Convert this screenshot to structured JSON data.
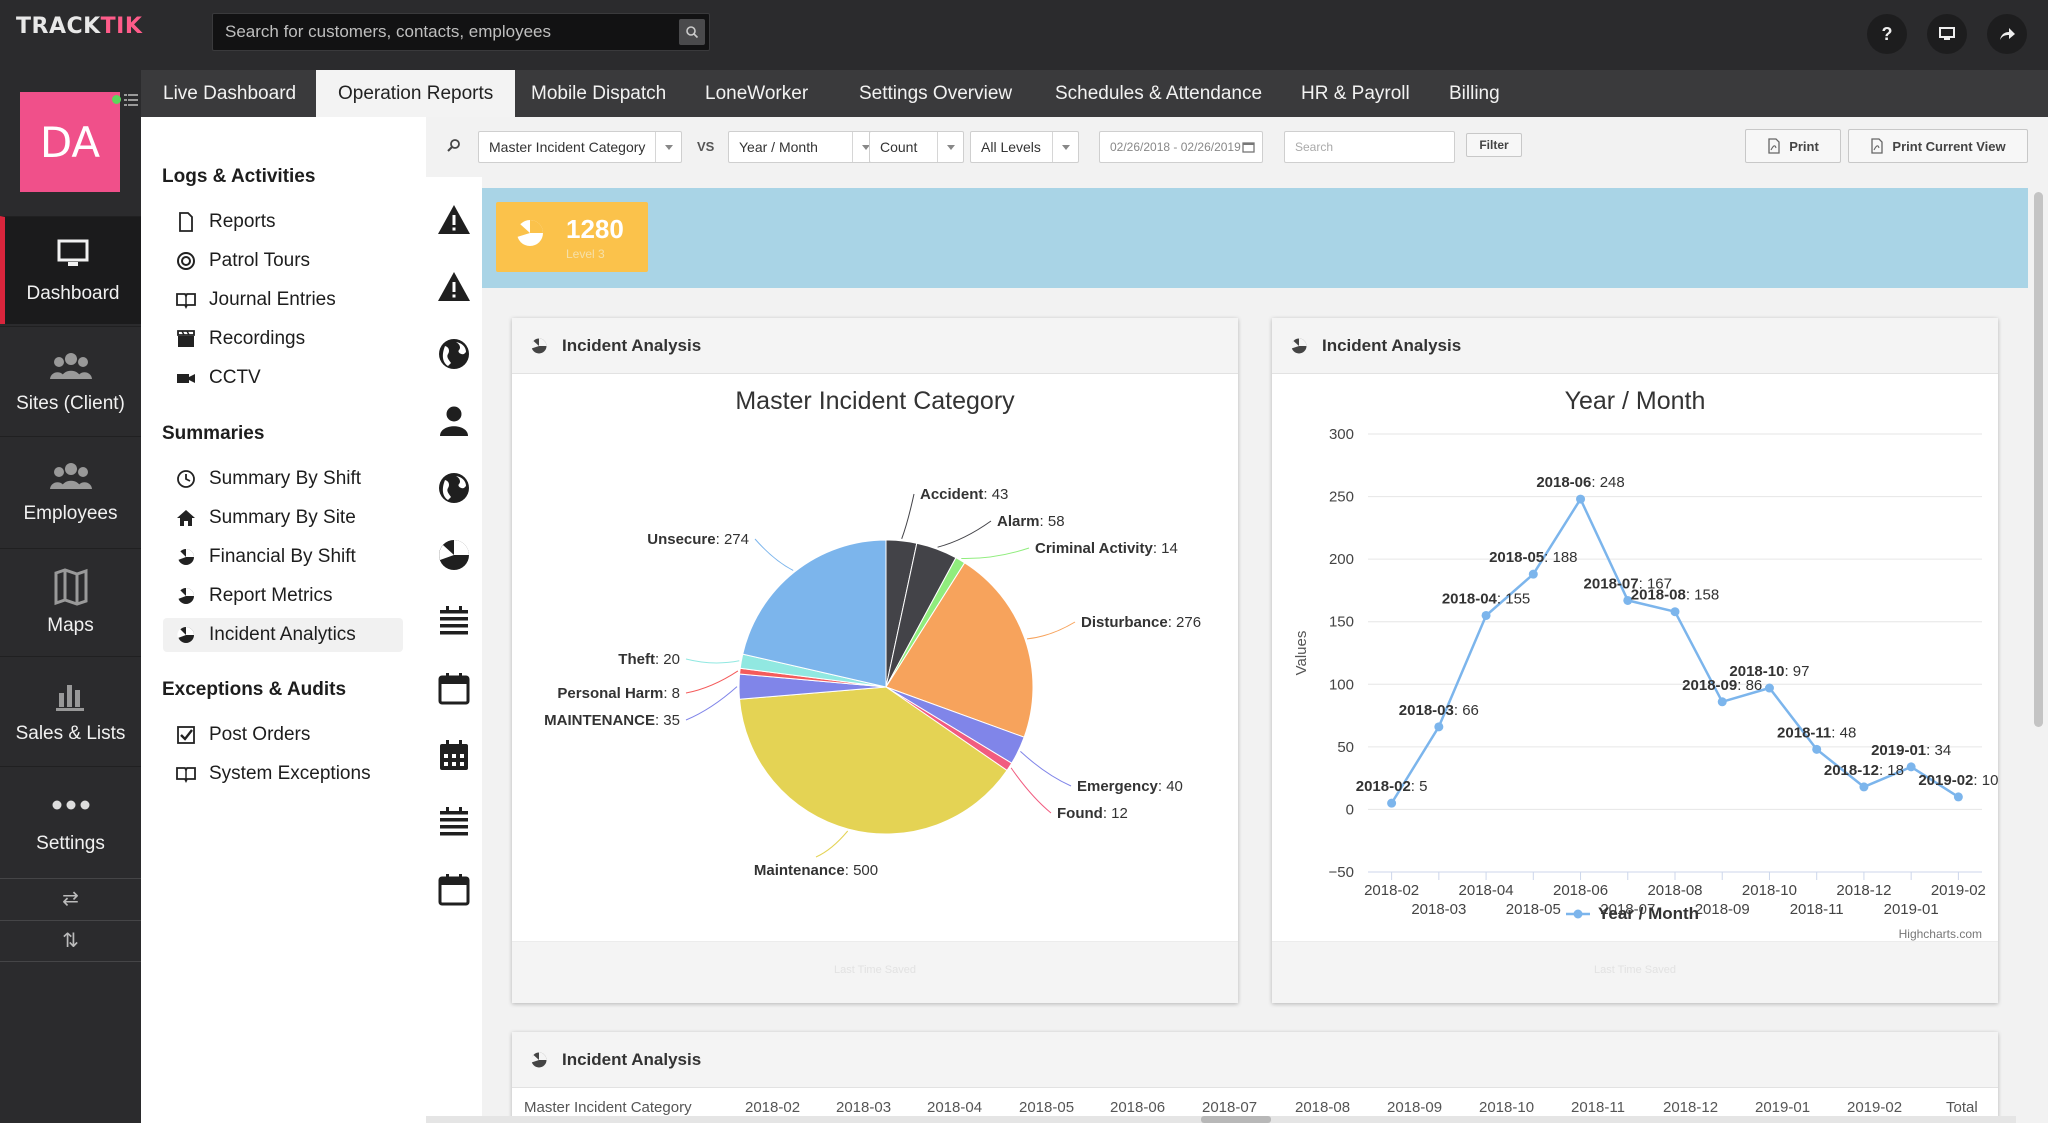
{
  "app": {
    "logo_track": "TRACK",
    "logo_tik": "TIK",
    "search_placeholder": "Search for customers, contacts, employees",
    "help_label": "?"
  },
  "user": {
    "initials": "DA",
    "online_color": "#5cd65c"
  },
  "leftnav": {
    "items": [
      {
        "label": "Dashboard",
        "icon": "monitor-icon"
      },
      {
        "label": "Sites (Client)",
        "icon": "users-icon"
      },
      {
        "label": "Employees",
        "icon": "users-icon"
      },
      {
        "label": "Maps",
        "icon": "map-icon"
      },
      {
        "label": "Sales & Lists",
        "icon": "bar-chart-icon"
      },
      {
        "label": "Settings",
        "icon": "dots-icon"
      }
    ],
    "toggle1": "⇄",
    "toggle2": "⇅"
  },
  "tabs": [
    "Live Dashboard",
    "Operation Reports",
    "Mobile Dispatch",
    "LoneWorker",
    "Settings Overview",
    "Schedules & Attendance",
    "HR & Payroll",
    "Billing"
  ],
  "subnav": {
    "sections": [
      {
        "title": "Logs & Activities",
        "items": [
          "Reports",
          "Patrol Tours",
          "Journal Entries",
          "Recordings",
          "CCTV"
        ]
      },
      {
        "title": "Summaries",
        "items": [
          "Summary By Shift",
          "Summary By Site",
          "Financial By Shift",
          "Report Metrics",
          "Incident Analytics"
        ]
      },
      {
        "title": "Exceptions & Audits",
        "items": [
          "Post Orders",
          "System Exceptions"
        ]
      }
    ]
  },
  "filters": {
    "category": "Master Incident Category",
    "vs": "VS",
    "period": "Year / Month",
    "measure": "Count",
    "levels": "All Levels",
    "date_range": "02/26/2018 - 02/26/2019",
    "search_placeholder": "Search",
    "filter_button": "Filter",
    "print_button": "Print",
    "print_view_button": "Print Current View"
  },
  "kpi": {
    "value": "1280",
    "label": "Level 3"
  },
  "cards": {
    "pie_header": "Incident Analysis",
    "line_header": "Incident Analysis",
    "table_header": "Incident Analysis",
    "pie_footer": "Last Time Saved",
    "line_footer": "Last Time Saved",
    "credit": "Highcharts.com"
  },
  "table": {
    "columns": [
      "Master Incident Category",
      "2018-02",
      "2018-03",
      "2018-04",
      "2018-05",
      "2018-06",
      "2018-07",
      "2018-08",
      "2018-09",
      "2018-10",
      "2018-11",
      "2018-12",
      "2019-01",
      "2019-02",
      "Total"
    ]
  },
  "chart_data": [
    {
      "type": "pie",
      "title": "Master Incident Category",
      "slices": [
        {
          "label": "Accident",
          "value": 43,
          "color": "#434348"
        },
        {
          "label": "Alarm",
          "value": 58,
          "color": "#434348"
        },
        {
          "label": "Criminal Activity",
          "value": 14,
          "color": "#90ed7d"
        },
        {
          "label": "Disturbance",
          "value": 276,
          "color": "#f7a35c"
        },
        {
          "label": "Emergency",
          "value": 40,
          "color": "#8085e9"
        },
        {
          "label": "Found",
          "value": 12,
          "color": "#f15c80"
        },
        {
          "label": "Maintenance",
          "value": 500,
          "color": "#e4d354"
        },
        {
          "label": "MAINTENANCE",
          "value": 35,
          "color": "#8085e9"
        },
        {
          "label": "Personal Harm",
          "value": 8,
          "color": "#f45b5b"
        },
        {
          "label": "Theft",
          "value": 20,
          "color": "#91e8e1"
        },
        {
          "label": "Unsecure",
          "value": 274,
          "color": "#7cb5ec"
        }
      ]
    },
    {
      "type": "line",
      "title": "Year / Month",
      "ylabel": "Values",
      "ylim": [
        -50,
        300
      ],
      "yticks": [
        -50,
        0,
        50,
        100,
        150,
        200,
        250,
        300
      ],
      "legend": "bottom-center",
      "grid": true,
      "series": [
        {
          "name": "Year / Month",
          "color": "#7cb5ec",
          "x": [
            "2018-02",
            "2018-03",
            "2018-04",
            "2018-05",
            "2018-06",
            "2018-07",
            "2018-08",
            "2018-09",
            "2018-10",
            "2018-11",
            "2018-12",
            "2019-01",
            "2019-02"
          ],
          "values": [
            5,
            66,
            155,
            188,
            248,
            167,
            158,
            86,
            97,
            48,
            18,
            34,
            10
          ]
        }
      ]
    }
  ]
}
